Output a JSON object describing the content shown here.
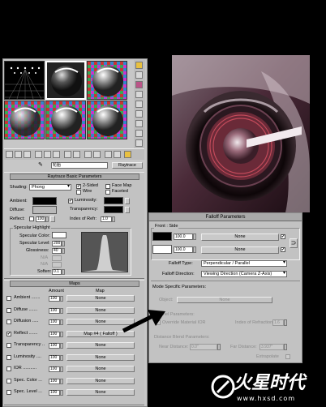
{
  "slots": [
    {
      "name": "sample-slot-1"
    },
    {
      "name": "sample-slot-2"
    },
    {
      "name": "sample-slot-3"
    },
    {
      "name": "sample-slot-4"
    },
    {
      "name": "sample-slot-5"
    },
    {
      "name": "sample-slot-6"
    }
  ],
  "toolbar": {
    "material_name": "轮胎",
    "material_type": "Raytrace"
  },
  "raytrace": {
    "rollout_title": "Raytrace Basic Parameters",
    "shading_label": "Shading:",
    "shading_value": "Phong",
    "two_sided": "2-Sided",
    "wire": "Wire",
    "face_map": "Face Map",
    "faceted": "Faceted",
    "ambient": "Ambient:",
    "diffuse": "Diffuse:",
    "reflect": "Reflect:",
    "reflect_value": "100",
    "luminosity": "Luminosity:",
    "transparency": "Transparency:",
    "index_of_refr": "Index of Refr:",
    "ior_value": "1.0",
    "spec_group": "Specular Highlight",
    "spec_color": "Specular Color:",
    "spec_level": "Specular Level:",
    "spec_level_value": "200",
    "glossiness": "Glossiness:",
    "glossiness_value": "40",
    "na1": "N/A",
    "na2": "N/A",
    "soften": "Soften:",
    "soften_value": "0.1"
  },
  "maps": {
    "title": "Maps",
    "amount_header": "Amount",
    "map_header": "Map",
    "rows": [
      {
        "label": "Ambient .......",
        "amount": "100",
        "map": "None",
        "checked": ""
      },
      {
        "label": "Diffuse .......",
        "amount": "100",
        "map": "None",
        "checked": ""
      },
      {
        "label": "Diffusion .....",
        "amount": "100",
        "map": "None",
        "checked": ""
      },
      {
        "label": "Reflect .......",
        "amount": "100",
        "map": "Map #4 ( Falloff )",
        "checked": "✔"
      },
      {
        "label": "Transparency ..",
        "amount": "100",
        "map": "None",
        "checked": ""
      },
      {
        "label": "Luminosity ....",
        "amount": "100",
        "map": "None",
        "checked": ""
      },
      {
        "label": "IOR ...........",
        "amount": "100",
        "map": "None",
        "checked": ""
      },
      {
        "label": "Spec. Color ...",
        "amount": "100",
        "map": "None",
        "checked": ""
      },
      {
        "label": "Spec. Level ...",
        "amount": "100",
        "map": "None",
        "checked": ""
      }
    ]
  },
  "falloff": {
    "title": "Falloff Parameters",
    "front_side": "Front : Side",
    "value1": "100.0",
    "value2": "100.0",
    "none": "None",
    "type_label": "Falloff Type:",
    "type_value": "Perpendicular / Parallel",
    "direction_label": "Falloff Direction:",
    "direction_value": "Viewing Direction (Camera Z-Axis)",
    "mode_title": "Mode Specific Parameters:",
    "object_label": "Object:",
    "object_value": "None",
    "fresnel_params": "Fresnel Parameters:",
    "override_label": "Override Material IOR",
    "ior_label": "Index of Refraction",
    "ior_value": "1.6",
    "distance_title": "Distance Blend Parameters:",
    "near_label": "Near Distance:",
    "near_value": "0.0\"",
    "far_label": "Far Distance:",
    "far_value": "3.937\"",
    "extrapolate": "Extrapolate"
  },
  "watermark": {
    "brand": "火星时代",
    "url": "www.hxsd.com"
  },
  "colors": {
    "ambient": "#000000",
    "diffuse": "#b9b9b9",
    "luminosity": "#000000",
    "transparency": "#000000",
    "spec_color": "#ffffff",
    "falloff_front": "#000000",
    "falloff_side": "#ffffff"
  }
}
